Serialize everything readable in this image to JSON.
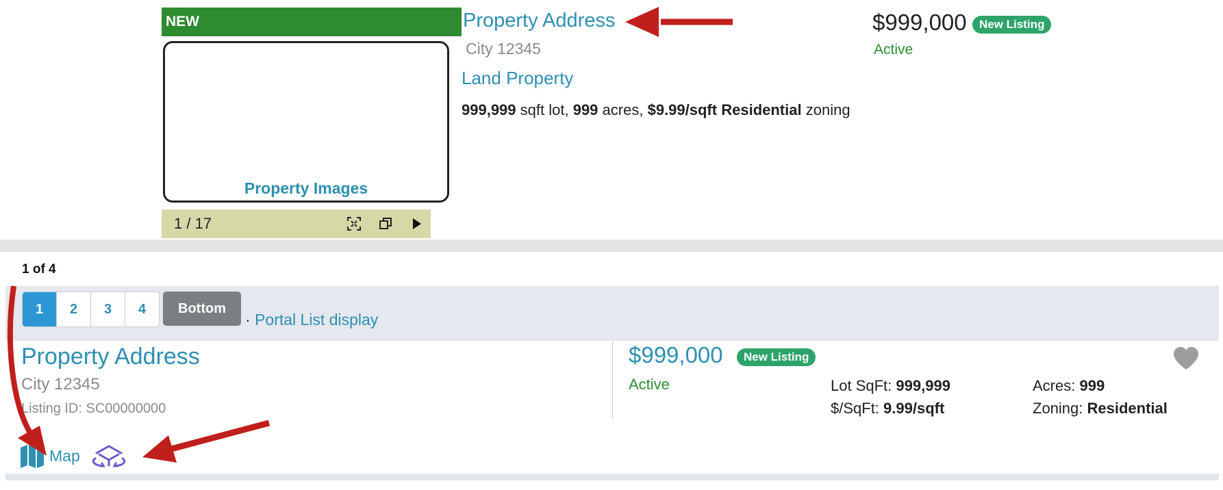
{
  "top_listing": {
    "banner_label": "NEW",
    "image_placeholder": "Property Images",
    "gallery": {
      "counter": "1 / 17",
      "fullscreen_icon": "expand-icon",
      "popout_icon": "popout-icon",
      "next_icon": "play-icon"
    },
    "address": "Property Address",
    "city": "City 12345",
    "property_type": "Land Property",
    "facts": {
      "lot_sqft": "999,999",
      "lot_sqft_label": "sqft lot,",
      "acres": "999",
      "acres_label": "acres,",
      "price_per_sqft": "$9.99/sqft",
      "zoning": "Residential",
      "zoning_label": "zoning"
    },
    "price": "$999,000",
    "badge": "New Listing",
    "status": "Active"
  },
  "pagination": {
    "summary": "1 of 4",
    "pages": [
      "1",
      "2",
      "3",
      "4"
    ],
    "active_page": "1",
    "bottom_button": "Bottom",
    "separator": "·",
    "portal_link": "Portal List display"
  },
  "bottom_listing": {
    "address": "Property Address",
    "city": "City 12345",
    "listing_id": "Listing ID: SC00000000",
    "price": "$999,000",
    "badge": "New Listing",
    "status": "Active",
    "lot_sqft_label": "Lot SqFt:",
    "lot_sqft_value": "999,999",
    "price_sqft_label": "$/SqFt:",
    "price_sqft_value": "9.99/sqft",
    "acres_label": "Acres:",
    "acres_value": "999",
    "zoning_label": "Zoning:",
    "zoning_value": "Residential",
    "favorite_icon": "heart-icon",
    "map_icon": "map-icon",
    "map_label": "Map",
    "virtual_tour_icon": "virtual-tour-icon"
  },
  "annotations": {
    "arrow_color": "#c0201c"
  },
  "colors": {
    "link": "#2e8fb0",
    "active_green": "#2e8b30",
    "badge_green": "#2ea36a",
    "new_banner": "#2e8b30",
    "page_active": "#2d97d6"
  }
}
